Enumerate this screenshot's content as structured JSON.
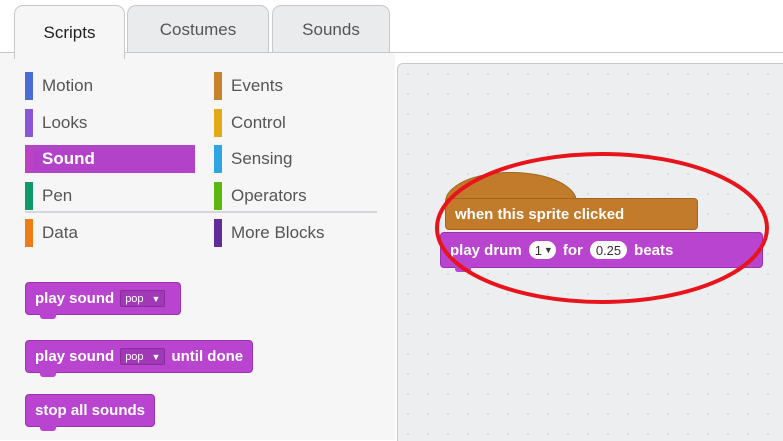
{
  "tabs": [
    {
      "label": "Scripts",
      "active": true
    },
    {
      "label": "Costumes",
      "active": false
    },
    {
      "label": "Sounds",
      "active": false
    }
  ],
  "categories": {
    "left": [
      {
        "label": "Motion",
        "color": "#4a6cd4"
      },
      {
        "label": "Looks",
        "color": "#8a55d7"
      },
      {
        "label": "Sound",
        "color": "#bb42c3",
        "selected": true
      },
      {
        "label": "Pen",
        "color": "#0e9a6c"
      },
      {
        "label": "Data",
        "color": "#ee7d16"
      }
    ],
    "right": [
      {
        "label": "Events",
        "color": "#c88330"
      },
      {
        "label": "Control",
        "color": "#e1a91a"
      },
      {
        "label": "Sensing",
        "color": "#2ca5e2"
      },
      {
        "label": "Operators",
        "color": "#5cb712"
      },
      {
        "label": "More Blocks",
        "color": "#632d99"
      }
    ]
  },
  "palette_blocks": {
    "play_sound": {
      "text": "play sound",
      "option": "pop"
    },
    "play_sound_until": {
      "text": "play sound",
      "option": "pop",
      "suffix": "until done"
    },
    "stop_all": {
      "text": "stop all sounds"
    }
  },
  "script": {
    "hat_label": "when this sprite clicked",
    "drum": {
      "text": "play drum",
      "drum_value": "1",
      "for_text": "for",
      "beats_value": "0.25",
      "beats_text": "beats"
    }
  },
  "colors": {
    "sound": "#b944cf",
    "events": "#c27a2b",
    "highlight_ellipse": "#e8141b"
  }
}
